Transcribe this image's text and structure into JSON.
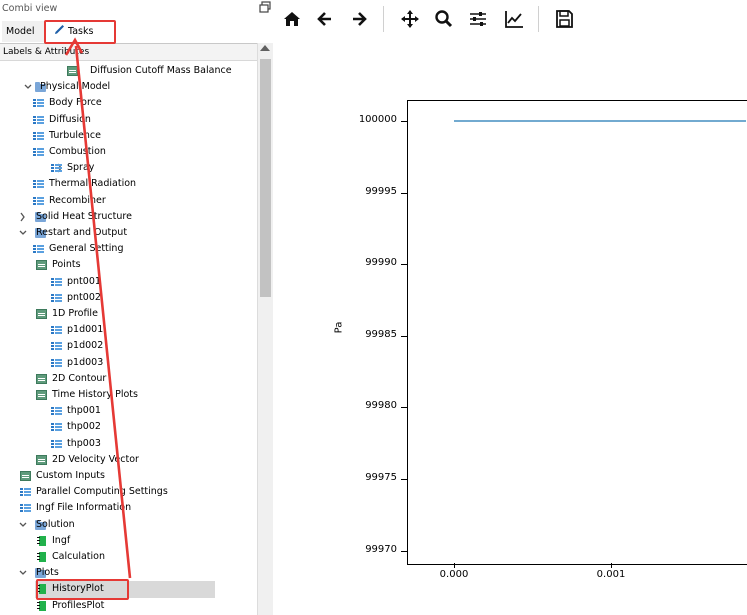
{
  "panel": {
    "title": "Combi view",
    "tabs": [
      {
        "label": "Model"
      },
      {
        "label": "Tasks"
      }
    ],
    "header": "Labels & Attributes"
  },
  "tree": [
    {
      "label": "Diffusion Cutoff Mass Balance",
      "icon": "table-icon"
    },
    {
      "label": "Physical Model",
      "icon": "folder-icon"
    },
    {
      "label": "Body Force",
      "icon": "list-icon"
    },
    {
      "label": "Diffusion",
      "icon": "list-icon"
    },
    {
      "label": "Turbulence",
      "icon": "list-icon"
    },
    {
      "label": "Combustion",
      "icon": "list-icon"
    },
    {
      "label": "Spray",
      "icon": "list-icon"
    },
    {
      "label": "Thermal Radiation",
      "icon": "list-icon"
    },
    {
      "label": "Recombiner",
      "icon": "list-icon"
    },
    {
      "label": "Solid Heat Structure",
      "icon": "folder-icon"
    },
    {
      "label": "Restart and Output",
      "icon": "folder-icon"
    },
    {
      "label": "General Setting",
      "icon": "list-icon"
    },
    {
      "label": "Points",
      "icon": "table-icon"
    },
    {
      "label": "pnt001",
      "icon": "list-icon"
    },
    {
      "label": "pnt002",
      "icon": "list-icon"
    },
    {
      "label": "1D Profile",
      "icon": "table-icon"
    },
    {
      "label": "p1d001",
      "icon": "list-icon"
    },
    {
      "label": "p1d002",
      "icon": "list-icon"
    },
    {
      "label": "p1d003",
      "icon": "list-icon"
    },
    {
      "label": "2D Contour",
      "icon": "table-icon"
    },
    {
      "label": "Time History Plots",
      "icon": "table-icon"
    },
    {
      "label": "thp001",
      "icon": "list-icon"
    },
    {
      "label": "thp002",
      "icon": "list-icon"
    },
    {
      "label": "thp003",
      "icon": "list-icon"
    },
    {
      "label": "2D Velocity Vector",
      "icon": "table-icon"
    },
    {
      "label": "Custom Inputs",
      "icon": "table-icon"
    },
    {
      "label": "Parallel Computing Settings",
      "icon": "list-icon"
    },
    {
      "label": "Ingf File Information",
      "icon": "list-icon"
    },
    {
      "label": "Solution",
      "icon": "folder-icon"
    },
    {
      "label": "Ingf",
      "icon": "green-task-icon"
    },
    {
      "label": "Calculation",
      "icon": "green-task-icon"
    },
    {
      "label": "Plots",
      "icon": "folder-icon"
    },
    {
      "label": "HistoryPlot",
      "icon": "green-task-icon"
    },
    {
      "label": "ProfilesPlot",
      "icon": "green-task-icon"
    }
  ],
  "toolbar": [
    "home-icon",
    "back-arrow-icon",
    "forward-arrow-icon",
    "pan-icon",
    "zoom-icon",
    "configure-subplots-icon",
    "edit-axis-icon",
    "save-icon"
  ],
  "chart_data": {
    "type": "line",
    "ylabel": "Pa",
    "xlabel": "",
    "title": "",
    "yticks": [
      "100000",
      "99995",
      "99990",
      "99985",
      "99980",
      "99975",
      "99970"
    ],
    "xticks": [
      "0.000",
      "0.001"
    ],
    "ylim": [
      99970,
      100000
    ],
    "series": [
      {
        "x": [
          0.0,
          0.0019
        ],
        "values": [
          100000,
          100000
        ],
        "color": "#1f77b4"
      }
    ]
  }
}
